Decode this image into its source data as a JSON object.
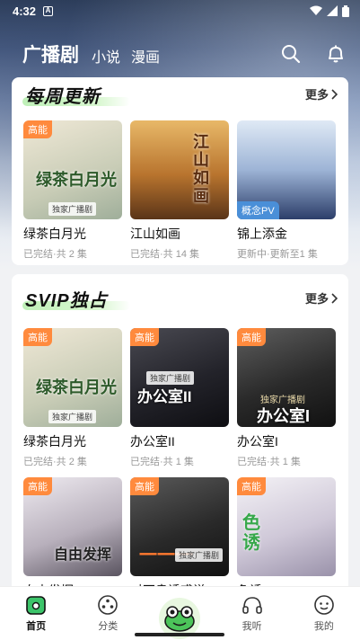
{
  "status_bar": {
    "time": "4:32",
    "notice_glyph": "A"
  },
  "header": {
    "tabs": [
      {
        "label": "广播剧",
        "active": true
      },
      {
        "label": "小说",
        "active": false
      },
      {
        "label": "漫画",
        "active": false
      }
    ]
  },
  "sections": [
    {
      "title": "每周更新",
      "more_label": "更多",
      "items": [
        {
          "title": "绿茶白月光",
          "subtitle": "已完结·共 2 集",
          "badge": "高能",
          "cover_text": "绿茶白月光",
          "cover_tag": "独家广播剧",
          "cover_colors": [
            "#e9e2cf",
            "#b9c3b0"
          ]
        },
        {
          "title": "江山如画",
          "subtitle": "已完结·共 14 集",
          "badge": "",
          "cover_text": "江山如画",
          "cover_tag": "",
          "cover_colors": [
            "#d6a45a",
            "#7a4a26"
          ]
        },
        {
          "title": "锦上添金",
          "subtitle": "更新中·更新至1 集",
          "badge": "概念PV",
          "cover_text": "",
          "cover_tag": "",
          "cover_colors": [
            "#cfe0f0",
            "#2a3f6a"
          ]
        }
      ]
    },
    {
      "title": "SVIP独占",
      "more_label": "更多",
      "items": [
        {
          "title": "绿茶白月光",
          "subtitle": "已完结·共 2 集",
          "badge": "高能",
          "cover_text": "绿茶白月光",
          "cover_tag": "独家广播剧",
          "cover_colors": [
            "#e9e2cf",
            "#b9c3b0"
          ]
        },
        {
          "title": "办公室II",
          "subtitle": "已完结·共 1 集",
          "badge": "高能",
          "cover_text": "办公室II",
          "cover_tag": "独家广播剧",
          "cover_colors": [
            "#3a3a40",
            "#15151a"
          ]
        },
        {
          "title": "办公室I",
          "subtitle": "已完结·共 1 集",
          "badge": "高能",
          "cover_text": "办公室I",
          "cover_tag": "独家广播剧",
          "cover_colors": [
            "#555",
            "#1c1c1c"
          ]
        },
        {
          "title": "自由发挥",
          "subtitle": "",
          "badge": "高能",
          "cover_text": "自由发挥",
          "cover_tag": "",
          "cover_colors": [
            "#e8e4ea",
            "#6a6470"
          ]
        },
        {
          "title": "对不良诱惑说",
          "subtitle": "",
          "badge": "高能",
          "cover_text": "一一一",
          "cover_tag": "独家广播剧",
          "cover_colors": [
            "#4a4a4a",
            "#1a1a1a"
          ]
        },
        {
          "title": "色诱",
          "subtitle": "",
          "badge": "高能",
          "cover_text": "色诱",
          "cover_tag": "",
          "cover_colors": [
            "#f0eef2",
            "#a8a0b8"
          ]
        }
      ]
    }
  ],
  "bottom_nav": [
    {
      "label": "首页",
      "icon": "home-icon",
      "active": true
    },
    {
      "label": "分类",
      "icon": "category-icon",
      "active": false
    },
    {
      "label": "",
      "icon": "frog-icon",
      "active": false
    },
    {
      "label": "我听",
      "icon": "headphones-icon",
      "active": false
    },
    {
      "label": "我的",
      "icon": "profile-icon",
      "active": false
    }
  ],
  "colors": {
    "accent_green": "#3cc46a",
    "badge_orange": "#ff8a3d"
  }
}
